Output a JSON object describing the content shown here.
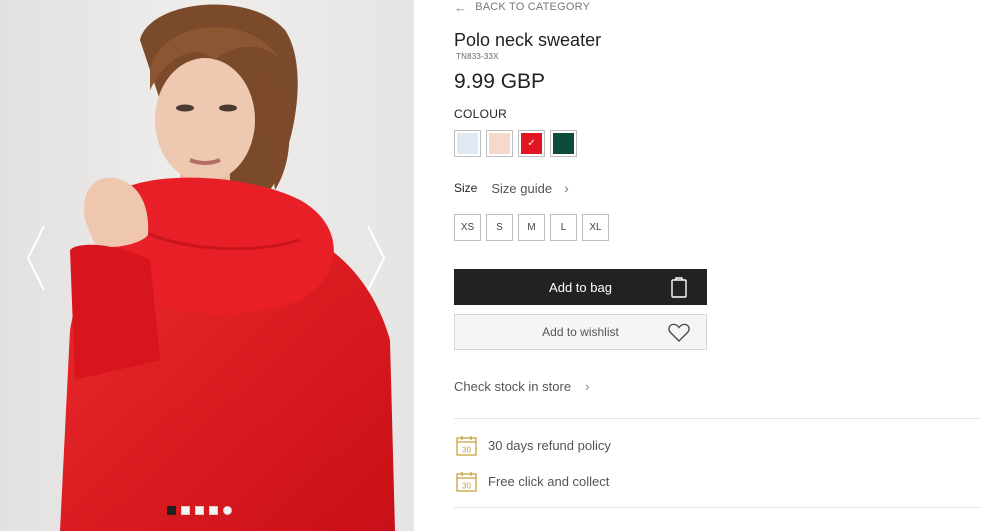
{
  "gallery": {
    "prev_icon": "chevron-left-icon",
    "next_icon": "chevron-right-icon",
    "dots": 5,
    "active_dot": 1
  },
  "product": {
    "back_label": "BACK TO CATEGORY",
    "title": "Polo neck sweater",
    "sku": "TN833-33X",
    "price": "9.99 GBP",
    "colour_label": "COLOUR",
    "colours": [
      {
        "name": "light-blue",
        "hex": "#dfe9f4",
        "selected": false
      },
      {
        "name": "pale-pink",
        "hex": "#f4d9cc",
        "selected": false
      },
      {
        "name": "red",
        "hex": "#e01722",
        "selected": true
      },
      {
        "name": "dark-green",
        "hex": "#0c4c3c",
        "selected": false
      }
    ],
    "size_label": "Size",
    "size_guide_label": "Size guide",
    "sizes": [
      "XS",
      "S",
      "M",
      "L",
      "XL"
    ],
    "add_to_bag_label": "Add to bag",
    "add_to_wishlist_label": "Add to wishlist",
    "check_stock_label": "Check stock in store"
  },
  "perks": [
    {
      "icon": "calendar-30-icon",
      "label": "30 days refund policy"
    },
    {
      "icon": "calendar-30-icon",
      "label": "Free click and collect"
    }
  ],
  "colors": {
    "accent_dark": "#222222",
    "icon_gold": "#c9a23c",
    "sweater_red": "#e01722"
  }
}
